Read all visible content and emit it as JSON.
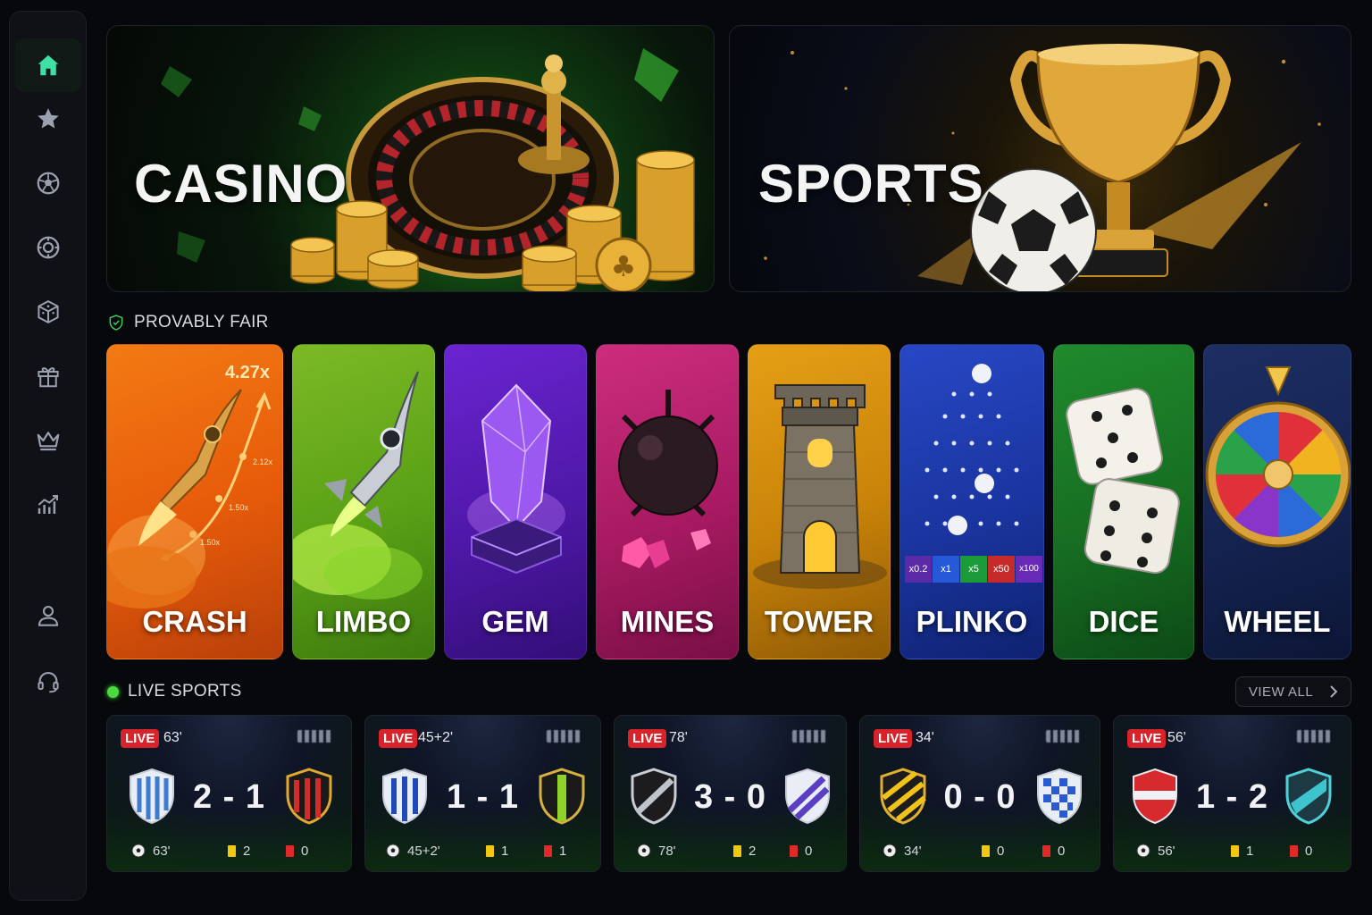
{
  "sidebar": {
    "items": [
      {
        "icon": "home-icon",
        "active": true
      },
      {
        "icon": "star-icon"
      },
      {
        "icon": "soccer-ball-icon"
      },
      {
        "icon": "casino-chip-icon"
      },
      {
        "icon": "dice-cube-icon"
      },
      {
        "icon": "gift-icon"
      },
      {
        "icon": "crown-icon"
      },
      {
        "icon": "stats-chart-icon"
      },
      {
        "icon": "user-icon"
      },
      {
        "icon": "headset-support-icon"
      }
    ],
    "accent": "#3ee0a8"
  },
  "banners": {
    "casino": {
      "title": "CASINO"
    },
    "sports": {
      "title": "SPORTS"
    }
  },
  "provably_fair": {
    "label": "PROVABLY FAIR"
  },
  "games": [
    {
      "label": "CRASH",
      "color": "#e8590c"
    },
    {
      "label": "LIMBO",
      "color": "#5fa319"
    },
    {
      "label": "GEM",
      "color": "#5a1fb8"
    },
    {
      "label": "MINES",
      "color": "#b51b6b"
    },
    {
      "label": "TOWER",
      "color": "#d58a0c"
    },
    {
      "label": "PLINKO",
      "color": "#1d38a6"
    },
    {
      "label": "DICE",
      "color": "#1a7a25"
    },
    {
      "label": "WHEEL",
      "color": "#15244d"
    }
  ],
  "crash_art": {
    "multiplier": "4.27x",
    "points": [
      "2.12x",
      "1.50x",
      "1.50x"
    ]
  },
  "plinko_art": {
    "slots": [
      "x0.2",
      "x1",
      "x5",
      "x50",
      "x100"
    ]
  },
  "live_sports": {
    "label": "LIVE SPORTS",
    "view_all": "VIEW ALL",
    "live_label": "LIVE",
    "matches": [
      {
        "minute": "63'",
        "score": "2 - 1",
        "yellow": "2",
        "red": "0"
      },
      {
        "minute": "45+2'",
        "score": "1 - 1",
        "yellow": "1",
        "red": "1"
      },
      {
        "minute": "78'",
        "score": "3 - 0",
        "yellow": "2",
        "red": "0"
      },
      {
        "minute": "34'",
        "score": "0 - 0",
        "yellow": "0",
        "red": "0"
      },
      {
        "minute": "56'",
        "score": "1 - 2",
        "yellow": "1",
        "red": "0"
      }
    ]
  }
}
